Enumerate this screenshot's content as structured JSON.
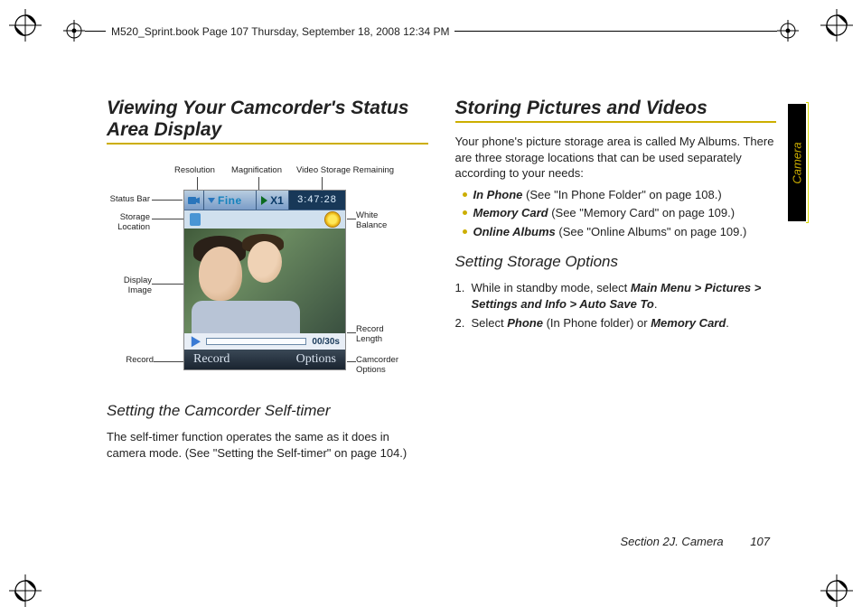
{
  "crop": true,
  "book_header": "M520_Sprint.book  Page 107  Thursday, September 18, 2008  12:34 PM",
  "side_tab": "Camera",
  "left": {
    "title": "Viewing Your Camcorder's Status Area Display",
    "diagram": {
      "labels": {
        "status_bar": "Status Bar",
        "resolution": "Resolution",
        "magnification": "Magnification",
        "video_storage": "Video Storage Remaining",
        "storage_location": "Storage\nLocation",
        "white_balance": "White\nBalance",
        "display_image": "Display\nImage",
        "record_length": "Record\nLength",
        "record": "Record",
        "cam_options": "Camcorder\nOptions"
      },
      "screen": {
        "resolution_value": "Fine",
        "zoom_value": "X1",
        "time_remaining": "3:47:28",
        "progress": "00/30s",
        "softkey_left": "Record",
        "softkey_right": "Options"
      }
    },
    "subhead": "Setting the Camcorder Self-timer",
    "body": "The self-timer function operates the same as it does in camera mode. (See \"Setting the Self-timer\" on page 104.)"
  },
  "right": {
    "title": "Storing Pictures and Videos",
    "intro": "Your phone's picture storage area is called My Albums. There are three storage locations that can be used separately according to your needs:",
    "bullets": [
      {
        "b": "In Phone",
        "t": " (See \"In Phone Folder\" on page 108.)"
      },
      {
        "b": "Memory Card",
        "t": " (See \"Memory Card\" on page 109.)"
      },
      {
        "b": "Online Albums",
        "t": " (See \"Online Albums\" on page 109.)"
      }
    ],
    "subhead": "Setting Storage Options",
    "steps": [
      {
        "n": "1.",
        "pre": "While in standby mode, select ",
        "path": "Main Menu > Pictures > Settings and Info > Auto Save To",
        "post": "."
      },
      {
        "n": "2.",
        "pre": "Select ",
        "b1": "Phone",
        "mid": " (In Phone folder) or ",
        "b2": "Memory Card",
        "post": "."
      }
    ]
  },
  "footer": {
    "section": "Section 2J. Camera",
    "page": "107"
  }
}
